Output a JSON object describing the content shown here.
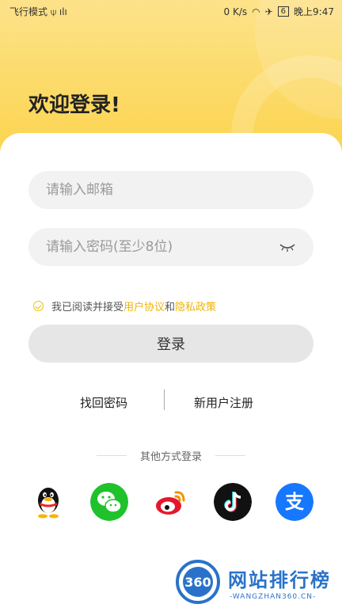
{
  "status": {
    "left": "飞行模式",
    "speed": "0 K/s",
    "battery": "6",
    "time": "晚上9:47"
  },
  "title": "欢迎登录!",
  "email": {
    "placeholder": "请输入邮箱",
    "value": ""
  },
  "password": {
    "placeholder": "请输入密码(至少8位)",
    "value": ""
  },
  "agreement": {
    "prefix": "我已阅读并接受",
    "user_agreement": "用户协议",
    "and": "和",
    "privacy": "隐私政策"
  },
  "login_label": "登录",
  "forgot_label": "找回密码",
  "register_label": "新用户注册",
  "other_login_label": "其他方式登录",
  "socials": [
    "qq-icon",
    "wechat-icon",
    "weibo-icon",
    "tiktok-icon",
    "alipay-icon"
  ],
  "watermark": {
    "badge": "360",
    "text": "网站排行榜",
    "url": "-WANGZHAN360.CN-"
  },
  "colors": {
    "accent": "#fbd34a",
    "link": "#f0b400",
    "button": "#e6e6e6"
  }
}
